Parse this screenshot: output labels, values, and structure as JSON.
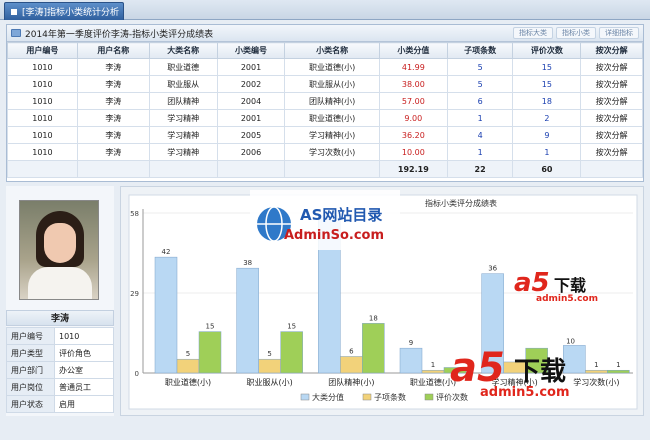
{
  "tab": {
    "label": "[李涛]指标小类统计分析"
  },
  "panel": {
    "title": "2014年第一季度评价李涛-指标小类评分成绩表",
    "buttons": [
      "指标大类",
      "指标小类",
      "详细指标"
    ]
  },
  "table": {
    "headers": [
      "用户编号",
      "用户名称",
      "大类名称",
      "小类编号",
      "小类名称",
      "小类分值",
      "子项条数",
      "评价次数",
      "按次分解"
    ],
    "rows": [
      [
        "1010",
        "李涛",
        "职业道德",
        "2001",
        "职业道德(小)",
        "41.99",
        "5",
        "15",
        "按次分解"
      ],
      [
        "1010",
        "李涛",
        "职业服从",
        "2002",
        "职业服从(小)",
        "38.00",
        "5",
        "15",
        "按次分解"
      ],
      [
        "1010",
        "李涛",
        "团队精神",
        "2004",
        "团队精神(小)",
        "57.00",
        "6",
        "18",
        "按次分解"
      ],
      [
        "1010",
        "李涛",
        "学习精神",
        "2001",
        "职业道德(小)",
        "9.00",
        "1",
        "2",
        "按次分解"
      ],
      [
        "1010",
        "李涛",
        "学习精神",
        "2005",
        "学习精神(小)",
        "36.20",
        "4",
        "9",
        "按次分解"
      ],
      [
        "1010",
        "李涛",
        "学习精神",
        "2006",
        "学习次数(小)",
        "10.00",
        "1",
        "1",
        "按次分解"
      ]
    ],
    "totals": [
      "",
      "",
      "",
      "",
      "",
      "192.19",
      "22",
      "60",
      ""
    ]
  },
  "user": {
    "name": "李涛",
    "fields": [
      {
        "key": "用户编号",
        "value": "1010"
      },
      {
        "key": "用户类型",
        "value": "评价角色"
      },
      {
        "key": "用户部门",
        "value": "办公室"
      },
      {
        "key": "用户岗位",
        "value": "普通员工"
      },
      {
        "key": "用户状态",
        "value": "启用"
      }
    ]
  },
  "watermarks": {
    "as_title": "AS网站目录",
    "as_url": "AdminSo.com",
    "a5_text": "下载",
    "a5_url": "admin5.com"
  },
  "chart_data": {
    "type": "bar",
    "title": "指标小类评分成绩表",
    "categories": [
      "职业道德(小)",
      "职业服从(小)",
      "团队精神(小)",
      "职业道德(小)",
      "学习精神(小)",
      "学习次数(小)"
    ],
    "ylim": [
      0,
      58
    ],
    "yticks": [
      0,
      29,
      58
    ],
    "legend_position": "bottom",
    "series": [
      {
        "name": "大类分值",
        "values": [
          42,
          38,
          57,
          9,
          36,
          10
        ],
        "color": "#b9d8f3"
      },
      {
        "name": "子项条数",
        "values": [
          5,
          5,
          6,
          1,
          4,
          1
        ],
        "color": "#f2d27a"
      },
      {
        "name": "评价次数",
        "values": [
          15,
          15,
          18,
          2,
          9,
          1
        ],
        "color": "#9fcf58"
      }
    ],
    "visible_labels": [
      [
        "42",
        "38",
        "",
        "9",
        "36",
        ""
      ],
      [
        "5",
        "5",
        "6",
        "1",
        "",
        "1"
      ],
      [
        "15",
        "15",
        "18",
        "",
        "",
        "1"
      ]
    ],
    "extra_label": "10"
  }
}
